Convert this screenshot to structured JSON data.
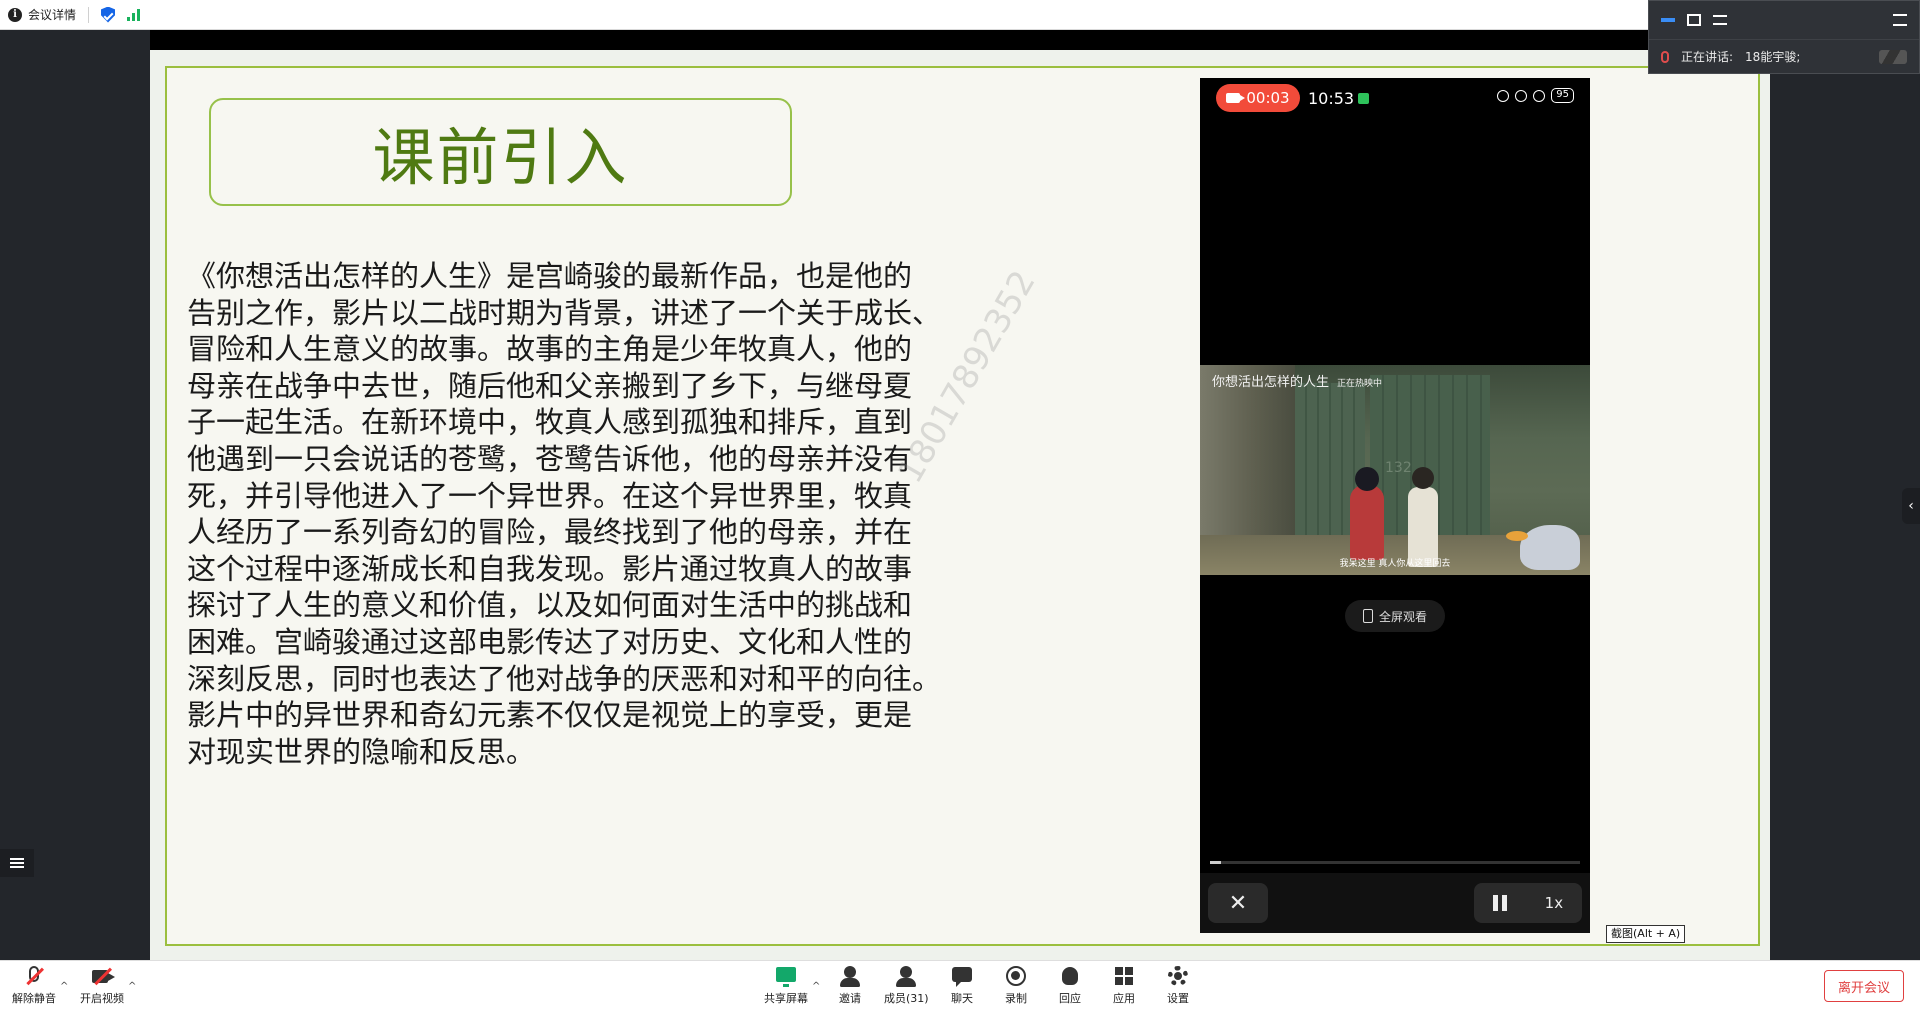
{
  "topbar": {
    "meeting_details": "会议详情"
  },
  "slide": {
    "title": "课前引入",
    "body_lines": [
      "《你想活出怎样的人生》是宫崎骏的最新作品，也是他的",
      "告别之作，影片以二战时期为背景，讲述了一个关于成长、",
      "冒险和人生意义的故事。故事的主角是少年牧真人，他的",
      "母亲在战争中去世，随后他和父亲搬到了乡下，与继母夏",
      "子一起生活。在新环境中，牧真人感到孤独和排斥，直到",
      "他遇到一只会说话的苍鹭，苍鹭告诉他，他的母亲并没有",
      "死，并引导他进入了一个异世界。在这个异世界里，牧真",
      "人经历了一系列奇幻的冒险，最终找到了他的母亲，并在",
      "这个过程中逐渐成长和自我发现。影片通过牧真人的故事",
      "探讨了人生的意义和价值，以及如何面对生活中的挑战和",
      "困难。宫崎骏通过这部电影传达了对历史、文化和人性的",
      "深刻反思，同时也表达了他对战争的厌恶和对和平的向往。",
      "影片中的异世界和奇幻元素不仅仅是视觉上的享受，更是",
      "对现实世界的隐喻和反思。"
    ],
    "watermark": "18017892352"
  },
  "phone": {
    "rec_time": "00:03",
    "clock": "10:53",
    "battery": "95",
    "movie_title": "你想活出怎样的人生",
    "movie_tag": "正在热映中",
    "door_number": "132",
    "subtitle": "我呆这里 真人你从这里回去",
    "fullscreen_label": "全屏观看",
    "speed_label": "1x",
    "close_glyph": "✕",
    "progress": 0.03
  },
  "speaking": {
    "label": "正在讲话:",
    "name": "18能宇骏;"
  },
  "screenshot_tip": "截图(Alt + A)",
  "toolbar": {
    "unmute": "解除静音",
    "start_video": "开启视频",
    "share": "共享屏幕",
    "invite": "邀请",
    "members": "成员(31)",
    "chat": "聊天",
    "record": "录制",
    "react": "回应",
    "apps": "应用",
    "settings": "设置",
    "leave": "离开会议"
  },
  "colors": {
    "accent": "#9bbf3f",
    "title_green": "#4f7a12",
    "rec_red": "#f24b3a",
    "leave_red": "#e04040"
  }
}
